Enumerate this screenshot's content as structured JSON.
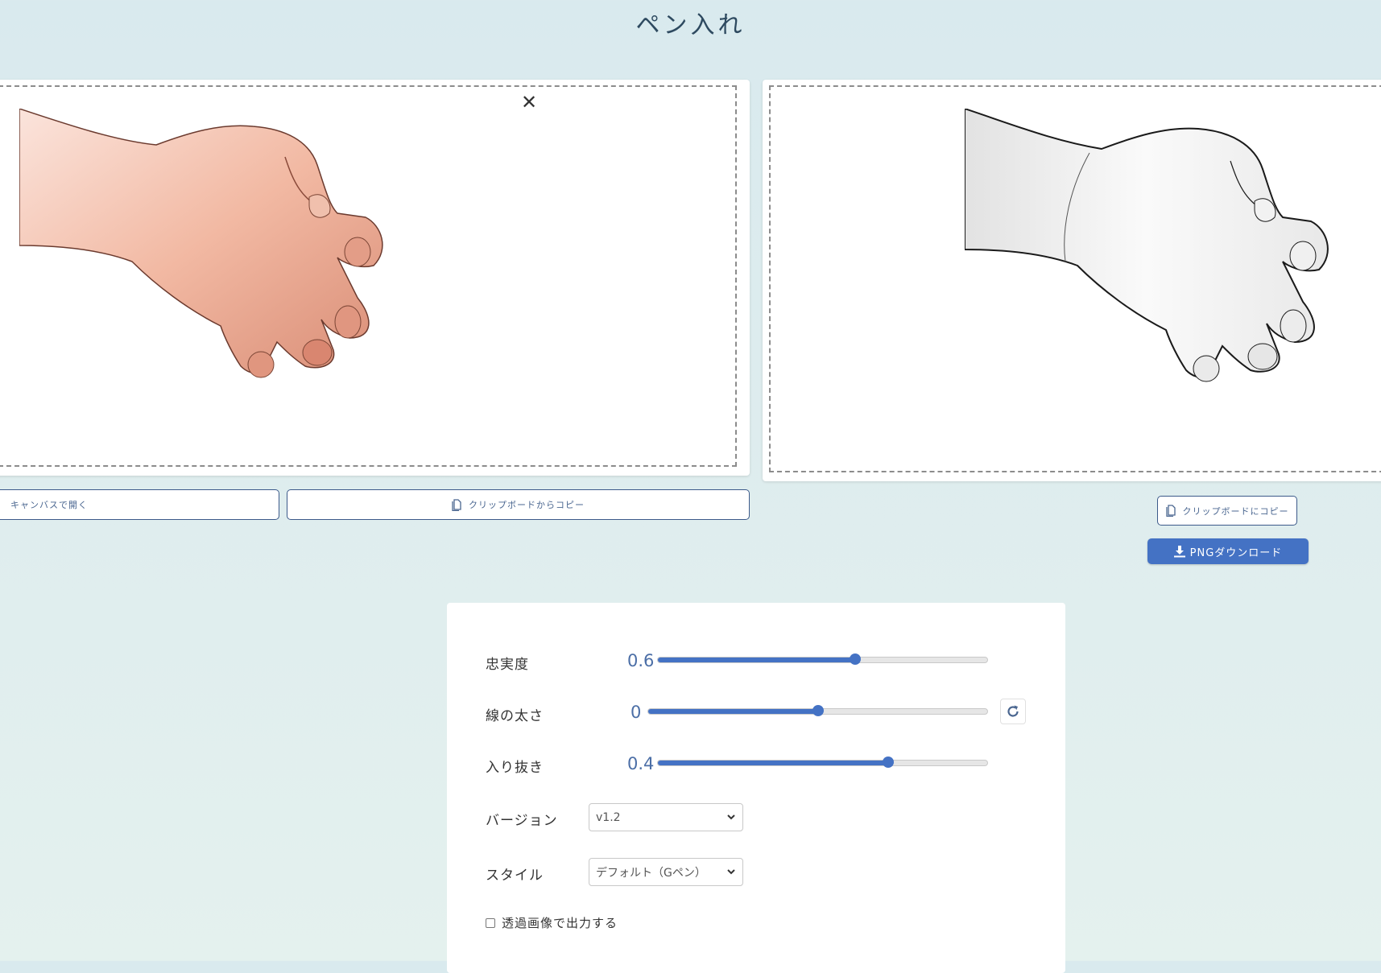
{
  "page": {
    "title": "ペン入れ"
  },
  "input_panel": {
    "open_canvas_label": "キャンバスで開く",
    "paste_label": "クリップボードからコピー"
  },
  "output_panel": {
    "copy_label": "クリップボードにコピー",
    "download_label": "PNGダウンロード"
  },
  "settings": {
    "fidelity": {
      "label": "忠実度",
      "value": "0.6",
      "level": 0.6
    },
    "line_width": {
      "label": "線の太さ",
      "value": "0",
      "level": 0.5
    },
    "taper": {
      "label": "入り抜き",
      "value": "0.4",
      "level": 0.7
    },
    "version": {
      "label": "バージョン",
      "selected": "v1.2"
    },
    "style": {
      "label": "スタイル",
      "selected": "デフォルト（Gペン）"
    },
    "transparent": {
      "label": "透過画像で出力する",
      "checked": false
    }
  },
  "colors": {
    "accent": "#4472c4"
  }
}
